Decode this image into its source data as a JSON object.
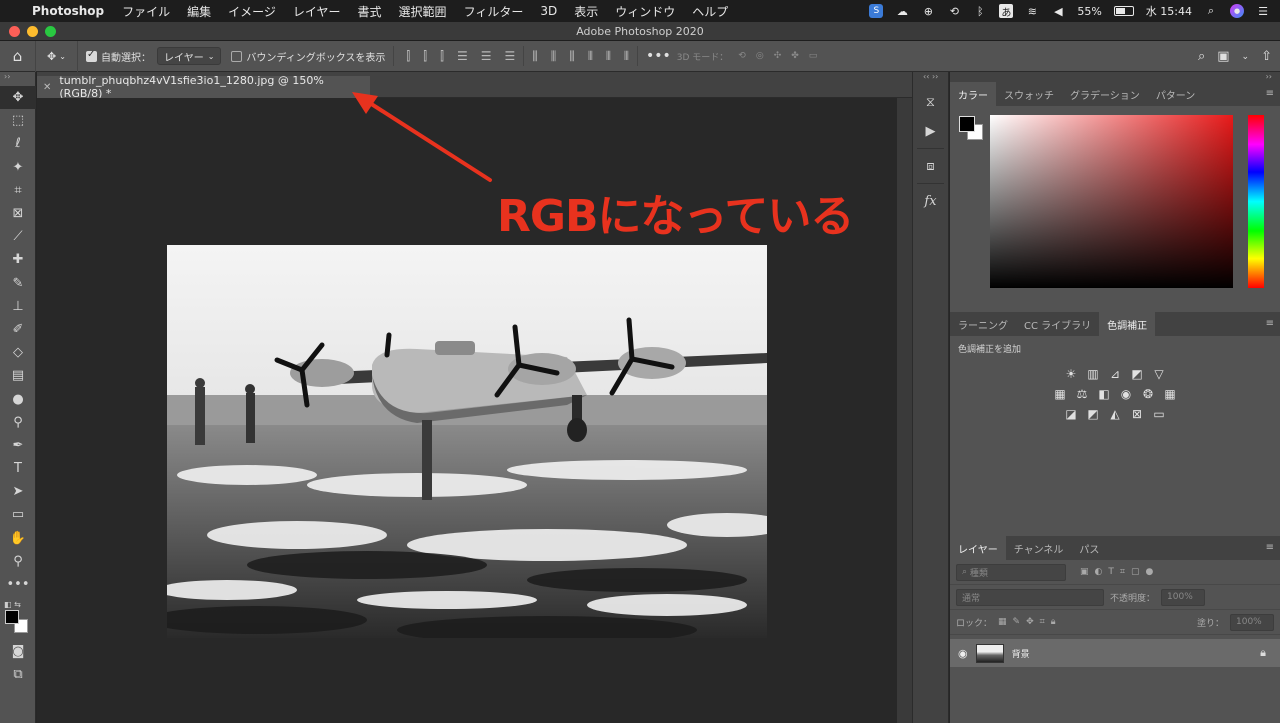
{
  "menubar": {
    "app": "Photoshop",
    "items": [
      "ファイル",
      "編集",
      "イメージ",
      "レイヤー",
      "書式",
      "選択範囲",
      "フィルター",
      "3D",
      "表示",
      "ウィンドウ",
      "ヘルプ"
    ],
    "battery": "55%",
    "clock": "水 15:44",
    "ime": "あ"
  },
  "window": {
    "title": "Adobe Photoshop 2020"
  },
  "options": {
    "auto_select_label": "自動選択：",
    "auto_select_value": "レイヤー",
    "bounding_box_label": "バウンディングボックスを表示",
    "mode_3d_label": "3D モード："
  },
  "document": {
    "tab_title": "tumblr_phuqbhz4vV1sfie3io1_1280.jpg @ 150% (RGB/8) *"
  },
  "annotation": {
    "text": "RGBになっている"
  },
  "color_panel": {
    "tabs": [
      "カラー",
      "スウォッチ",
      "グラデーション",
      "パターン"
    ]
  },
  "adjust_panel": {
    "tabs": [
      "ラーニング",
      "CC ライブラリ",
      "色調補正"
    ],
    "title": "色調補正を追加"
  },
  "layers_panel": {
    "tabs": [
      "レイヤー",
      "チャンネル",
      "パス"
    ],
    "filter_kind": "種類",
    "blend_mode": "通常",
    "opacity_label": "不透明度：",
    "opacity_value": "100%",
    "lock_label": "ロック：",
    "fill_label": "塗り：",
    "fill_value": "100%",
    "layer_name": "背景"
  },
  "colors": {
    "annotation": "#e8321e",
    "panel_bg": "#535353",
    "canvas_bg": "#282828"
  }
}
